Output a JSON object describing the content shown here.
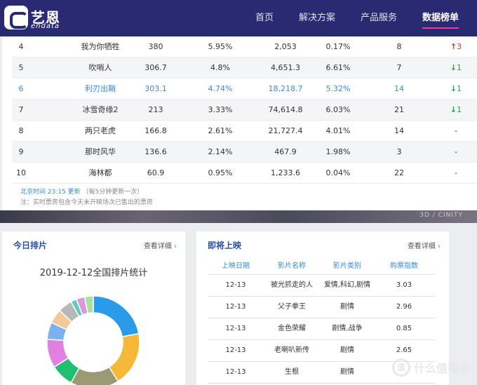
{
  "brand": {
    "name_cn": "艺恩",
    "name_en": "endata"
  },
  "nav": {
    "items": [
      "首页",
      "解决方案",
      "产品服务",
      "数据榜单"
    ],
    "active_index": 3
  },
  "ranking": {
    "rows": [
      {
        "rank": "4",
        "name": "我为你牺牲",
        "box": "380",
        "share": "5.95%",
        "total": "2,053",
        "rate": "0.17%",
        "days": "8",
        "trend_dir": "up",
        "trend_arrow": "↑",
        "trend_val": "3"
      },
      {
        "rank": "5",
        "name": "吹哨人",
        "box": "306.7",
        "share": "4.8%",
        "total": "4,651.3",
        "rate": "6.61%",
        "days": "7",
        "trend_dir": "down",
        "trend_arrow": "↓",
        "trend_val": "1"
      },
      {
        "rank": "6",
        "name": "利刃出鞘",
        "box": "303.1",
        "share": "4.74%",
        "total": "18,218.7",
        "rate": "5.32%",
        "days": "14",
        "trend_dir": "down",
        "trend_arrow": "↓",
        "trend_val": "1"
      },
      {
        "rank": "7",
        "name": "冰雪奇缘2",
        "box": "213",
        "share": "3.33%",
        "total": "74,614.8",
        "rate": "6.03%",
        "days": "21",
        "trend_dir": "down",
        "trend_arrow": "↓",
        "trend_val": "1"
      },
      {
        "rank": "8",
        "name": "两只老虎",
        "box": "166.8",
        "share": "2.61%",
        "total": "21,727.4",
        "rate": "4.01%",
        "days": "14",
        "trend_dir": "flat",
        "trend_arrow": "",
        "trend_val": "-"
      },
      {
        "rank": "9",
        "name": "那时风华",
        "box": "136.6",
        "share": "2.14%",
        "total": "467.9",
        "rate": "1.98%",
        "days": "3",
        "trend_dir": "flat",
        "trend_arrow": "",
        "trend_val": "-"
      },
      {
        "rank": "10",
        "name": "海林都",
        "box": "60.9",
        "share": "0.95%",
        "total": "1,233.6",
        "rate": "0.04%",
        "days": "22",
        "trend_dir": "flat",
        "trend_arrow": "",
        "trend_val": "-"
      }
    ],
    "highlight_rank": "6",
    "update_time": "北京时间 23:15 更新",
    "update_note": "（每5分钟更新一次）",
    "footnote": "注：实时票房包含今天未开映场次已售出的票房"
  },
  "background": {
    "caption": "3D / CINITY"
  },
  "today": {
    "title": "今日排片",
    "more": "查看详细",
    "stat_title": "2019-12-12全国排片统计",
    "chart_data": {
      "type": "pie",
      "values": [
        22,
        19,
        17,
        8,
        10,
        6,
        5,
        5,
        2,
        3,
        3
      ],
      "colors": [
        "#2a9be8",
        "#f5b838",
        "#9c9a74",
        "#20c070",
        "#e080e0",
        "#7ab2f0",
        "#f5c898",
        "#b8b8b8",
        "#60c8c0",
        "#d89ad8",
        "#a8e0a0"
      ],
      "title": "2019-12-12全国排片统计"
    }
  },
  "upcoming": {
    "title": "即将上映",
    "more": "查看详细",
    "headers": [
      "上映日期",
      "影片名称",
      "影片类别",
      "购票指数"
    ],
    "rows": [
      {
        "date": "12-13",
        "name": "被光抓走的人",
        "type": "爱情,科幻,剧情",
        "index": "3.03"
      },
      {
        "date": "12-13",
        "name": "父子拳王",
        "type": "剧情",
        "index": "2.96"
      },
      {
        "date": "12-13",
        "name": "金色荣耀",
        "type": "剧情,战争",
        "index": "0.85"
      },
      {
        "date": "12-13",
        "name": "老喇叭新传",
        "type": "剧情",
        "index": "2.65"
      },
      {
        "date": "12-13",
        "name": "生根",
        "type": "剧情",
        "index": ""
      }
    ]
  },
  "watermark": {
    "text": "什么值得买",
    "badge": "值"
  }
}
